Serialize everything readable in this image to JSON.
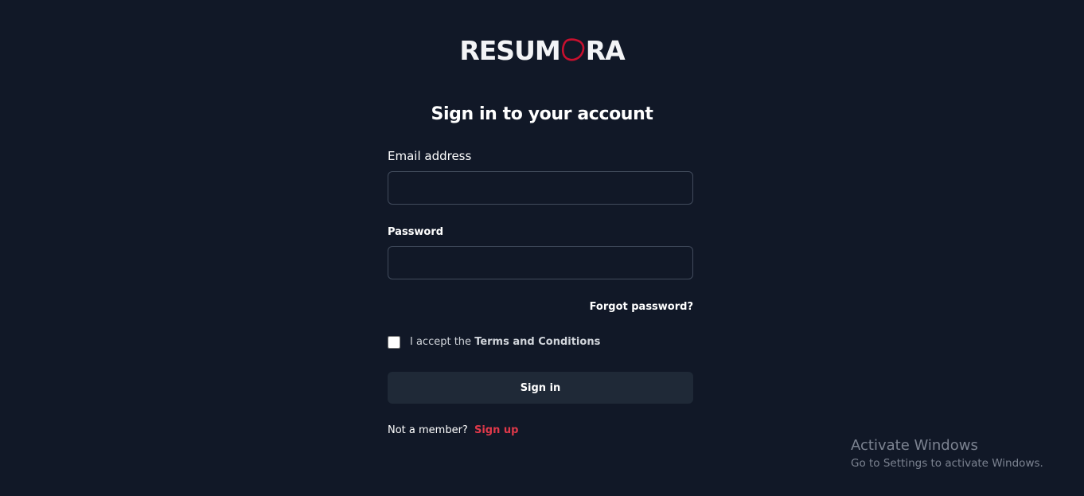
{
  "brand": {
    "name_left": "RESUM",
    "name_right": "RA",
    "accent_color": "#c8102e"
  },
  "login": {
    "title": "Sign in to your account",
    "email_label": "Email address",
    "email_value": "",
    "password_label": "Password",
    "password_value": "",
    "forgot_link": "Forgot password?",
    "terms_prefix": "I accept the",
    "terms_link": "Terms and Conditions",
    "terms_checked": false,
    "submit_label": "Sign in",
    "member_prompt": "Not a member?",
    "signup_link": "Sign up"
  },
  "watermark": {
    "title": "Activate Windows",
    "subtitle": "Go to Settings to activate Windows."
  },
  "colors": {
    "background": "#111827",
    "button_bg": "#1f2937",
    "signup_link": "#e0394a"
  }
}
